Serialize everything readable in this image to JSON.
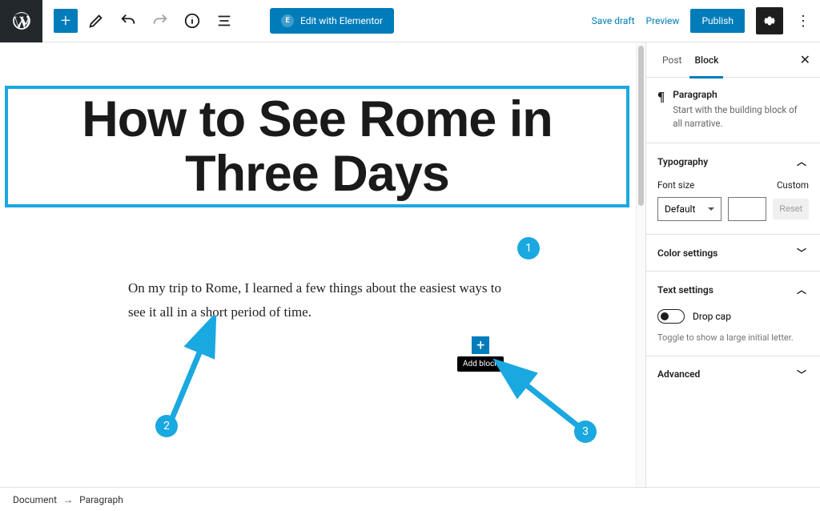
{
  "toolbar": {
    "elementor_label": "Edit with Elementor",
    "save_draft": "Save draft",
    "preview": "Preview",
    "publish": "Publish"
  },
  "content": {
    "title": "How to See Rome in Three Days",
    "paragraph": "On my trip to Rome, I learned a few things about the easiest ways to see it all in a short period of time.",
    "add_block_label": "Add block"
  },
  "annotations": {
    "badge1": "1",
    "badge2": "2",
    "badge3": "3"
  },
  "sidebar": {
    "tab_post": "Post",
    "tab_block": "Block",
    "block_name": "Paragraph",
    "block_desc": "Start with the building block of all narrative.",
    "typography": {
      "header": "Typography",
      "font_size_label": "Font size",
      "custom_label": "Custom",
      "font_size_value": "Default",
      "reset": "Reset"
    },
    "color_settings": "Color settings",
    "text_settings": {
      "header": "Text settings",
      "drop_cap": "Drop cap",
      "help": "Toggle to show a large initial letter."
    },
    "advanced": "Advanced"
  },
  "breadcrumb": {
    "root": "Document",
    "current": "Paragraph"
  }
}
